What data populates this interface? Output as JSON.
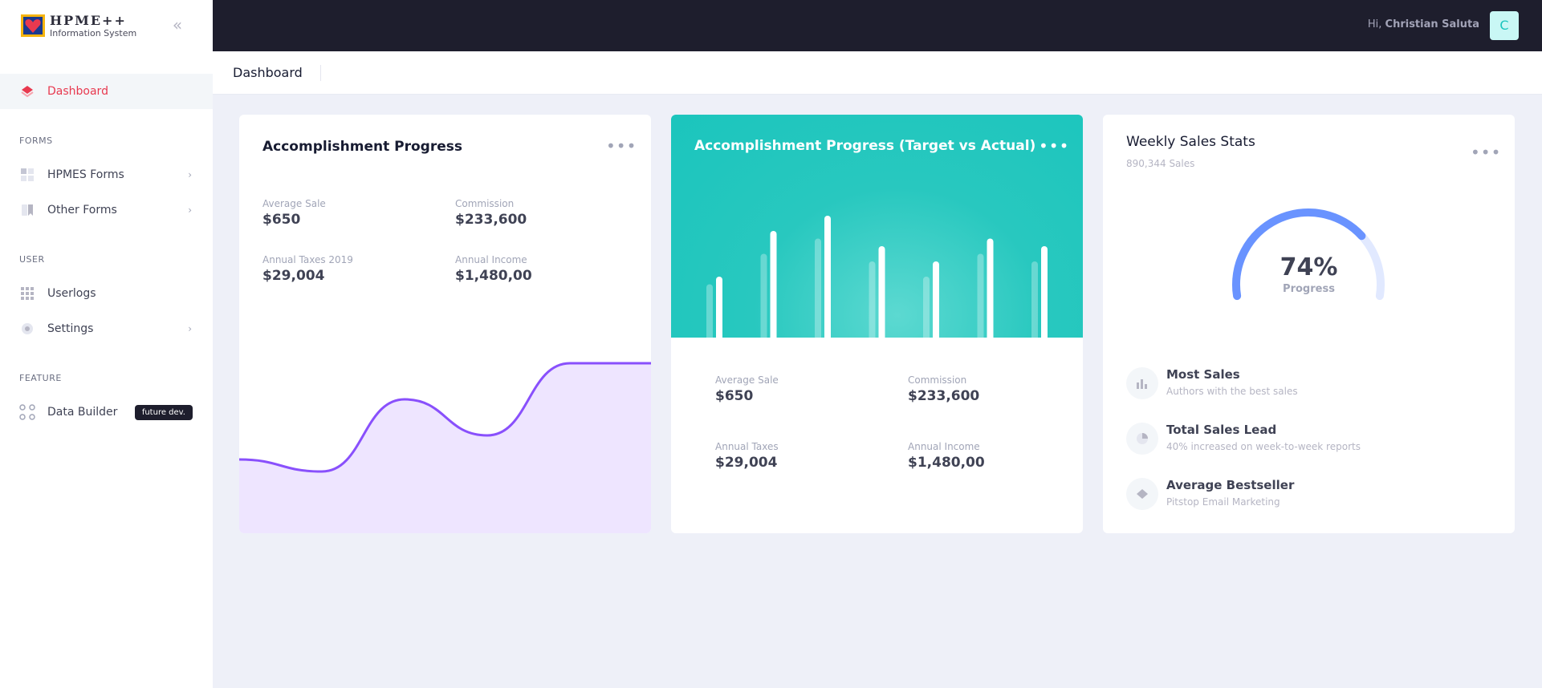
{
  "brand": {
    "title": "HPME++",
    "subtitle": "Information System"
  },
  "sidebar": {
    "items": [
      {
        "label": "Dashboard",
        "icon": "layers-icon",
        "active": true
      },
      {
        "section": "FORMS"
      },
      {
        "label": "HPMES Forms",
        "icon": "grid-icon",
        "has_arrow": true
      },
      {
        "label": "Other Forms",
        "icon": "bookmark-icon",
        "has_arrow": true
      },
      {
        "section": "USER"
      },
      {
        "label": "Userlogs",
        "icon": "dots-grid-icon"
      },
      {
        "label": "Settings",
        "icon": "gear-icon",
        "has_arrow": true
      },
      {
        "section": "FEATURE"
      },
      {
        "label": "Data Builder",
        "icon": "four-circles-icon",
        "badge": "future dev."
      }
    ]
  },
  "topbar": {
    "greeting_prefix": "Hi,",
    "user_name": "Christian Saluta",
    "avatar_letter": "C"
  },
  "subheader": {
    "title": "Dashboard"
  },
  "cards": {
    "progress": {
      "title": "Accomplishment Progress",
      "menu": "•••",
      "stats": [
        {
          "label": "Average Sale",
          "value": "$650"
        },
        {
          "label": "Commission",
          "value": "$233,600"
        },
        {
          "label": "Annual Taxes 2019",
          "value": "$29,004"
        },
        {
          "label": "Annual Income",
          "value": "$1,480,00"
        }
      ]
    },
    "target": {
      "title": "Accomplishment Progress (Target vs Actual)",
      "menu": "•••",
      "stats": [
        {
          "label": "Average Sale",
          "value": "$650"
        },
        {
          "label": "Commission",
          "value": "$233,600"
        },
        {
          "label": "Annual Taxes",
          "value": "$29,004"
        },
        {
          "label": "Annual Income",
          "value": "$1,480,00"
        }
      ]
    },
    "weekly": {
      "title": "Weekly Sales Stats",
      "subtitle": "890,344 Sales",
      "menu": "•••",
      "gauge_value": "74%",
      "gauge_label": "Progress",
      "items": [
        {
          "title": "Most Sales",
          "desc": "Authors with the best sales",
          "icon": "bar-chart-icon"
        },
        {
          "title": "Total Sales Lead",
          "desc": "40% increased on week-to-week reports",
          "icon": "pie-chart-icon"
        },
        {
          "title": "Average Bestseller",
          "desc": "Pitstop Email Marketing",
          "icon": "diamond-icon"
        }
      ]
    }
  },
  "colors": {
    "accent_red": "#e8394f",
    "teal": "#1bc5bd",
    "purple_line": "#8950fc",
    "purple_fill": "#eee5ff",
    "gauge_blue": "#6993ff",
    "dark": "#1e1e2d"
  },
  "chart_data": [
    {
      "type": "area",
      "title": "",
      "series": [
        {
          "values": [
            30,
            25,
            55,
            40,
            70,
            70
          ]
        }
      ],
      "ylim": [
        0,
        100
      ]
    },
    {
      "type": "bar",
      "title": "",
      "series": [
        {
          "values": [
            35,
            55,
            65,
            50,
            40,
            55,
            50
          ]
        },
        {
          "values": [
            40,
            70,
            80,
            60,
            50,
            65,
            60
          ]
        }
      ],
      "ylim": [
        0,
        100
      ]
    },
    {
      "type": "gauge",
      "value": 74,
      "label": "Progress"
    }
  ]
}
